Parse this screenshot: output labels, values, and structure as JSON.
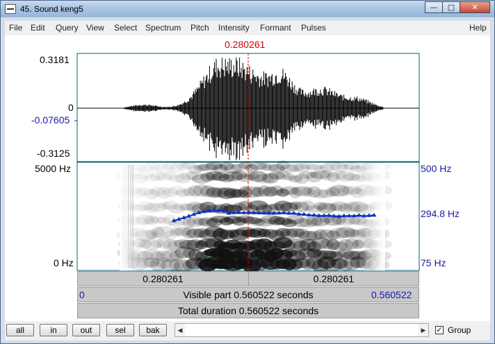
{
  "window": {
    "title": "45. Sound keng5",
    "controls": {
      "minimize": "—",
      "maximize": "□",
      "close": "✕"
    }
  },
  "menu": [
    "File",
    "Edit",
    "Query",
    "View",
    "Select",
    "Spectrum",
    "Pitch",
    "Intensity",
    "Formant",
    "Pulses",
    "Help"
  ],
  "cursor_time": "0.280261",
  "waveform": {
    "max_label": "0.3181",
    "zero_label": "0",
    "cursor_value": "-0.07605",
    "min_label": "-0.3125"
  },
  "spectrogram": {
    "freq_max": "5000 Hz",
    "freq_min": "0 Hz",
    "pitch_max": "500 Hz",
    "pitch_cursor": "294.8 Hz",
    "pitch_min": "75 Hz"
  },
  "time_bars": {
    "left_segment": "0.280261",
    "right_segment": "0.280261",
    "visible_start": "0",
    "visible_label": "Visible part 0.560522 seconds",
    "visible_end": "0.560522",
    "total_label": "Total duration 0.560522 seconds"
  },
  "buttons": {
    "all": "all",
    "in": "in",
    "out": "out",
    "sel": "sel",
    "bak": "bak"
  },
  "group": {
    "label": "Group",
    "checked": true,
    "mark": "✓"
  },
  "colors": {
    "cursor": "#d00000",
    "pitch": "#1030c0",
    "frame": "#006070",
    "blue_text": "#1a1aa6"
  },
  "icons": {
    "scroll_left": "◀",
    "scroll_right": "▶"
  }
}
